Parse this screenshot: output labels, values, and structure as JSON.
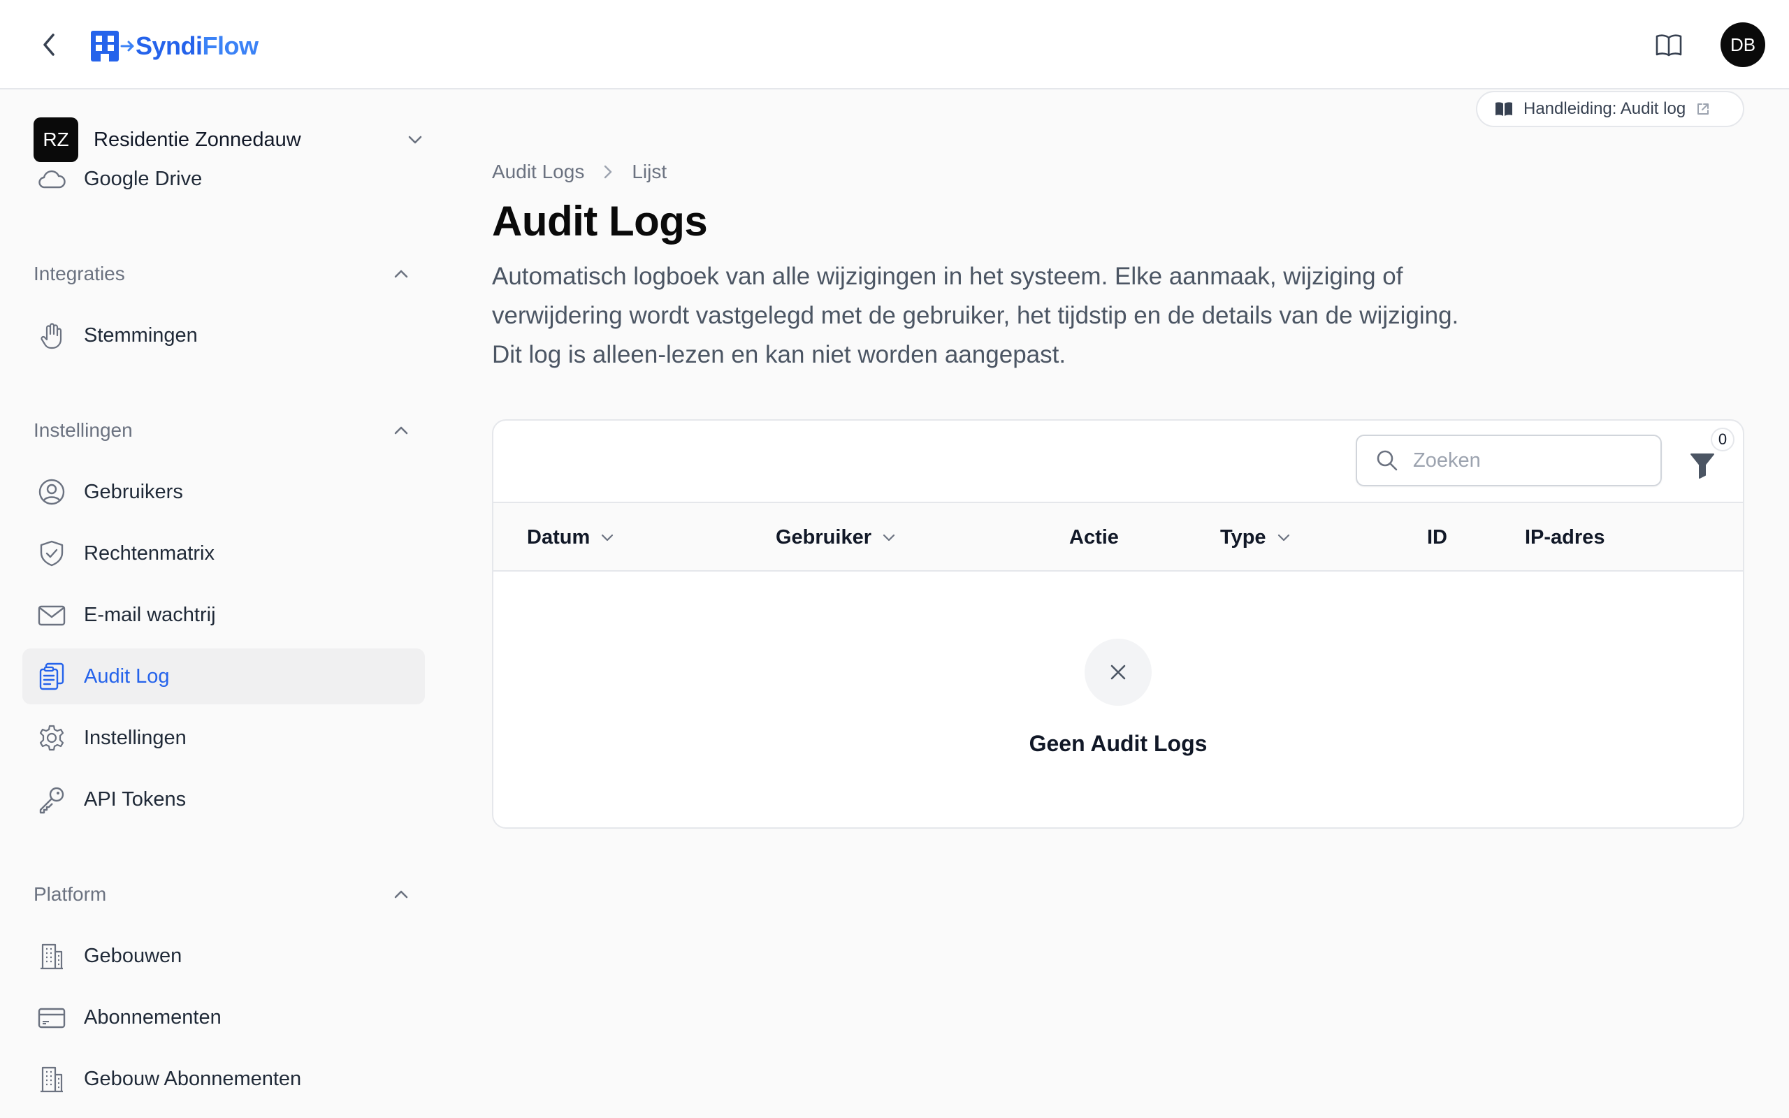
{
  "app": {
    "logo_part1": "Syndi",
    "logo_part2": "Flow",
    "user_initials": "DB"
  },
  "sidebar": {
    "tenant": {
      "initials": "RZ",
      "name": "Residentie Zonnedauw"
    },
    "partial_item": {
      "label": "Google Drive",
      "icon": "cloud-icon"
    },
    "groups": [
      {
        "label": "Integraties",
        "items": [
          {
            "label": "Stemmingen",
            "icon": "hand-icon"
          }
        ]
      },
      {
        "label": "Instellingen",
        "items": [
          {
            "label": "Gebruikers",
            "icon": "user-circle-icon"
          },
          {
            "label": "Rechtenmatrix",
            "icon": "shield-check-icon"
          },
          {
            "label": "E-mail wachtrij",
            "icon": "envelope-icon"
          },
          {
            "label": "Audit Log",
            "icon": "clipboard-list-icon",
            "active": true
          },
          {
            "label": "Instellingen",
            "icon": "cog-icon"
          },
          {
            "label": "API Tokens",
            "icon": "key-icon"
          }
        ]
      },
      {
        "label": "Platform",
        "items": [
          {
            "label": "Gebouwen",
            "icon": "building-icon"
          },
          {
            "label": "Abonnementen",
            "icon": "credit-card-icon"
          },
          {
            "label": "Gebouw Abonnementen",
            "icon": "building-icon"
          }
        ]
      }
    ]
  },
  "guide_button": {
    "label": "Handleiding: Audit log"
  },
  "breadcrumb": [
    "Audit Logs",
    "Lijst"
  ],
  "page": {
    "title": "Audit Logs",
    "description": "Automatisch logboek van alle wijzigingen in het systeem. Elke aanmaak, wijziging of verwijdering wordt vastgelegd met de gebruiker, het tijdstip en de details van de wijziging. Dit log is alleen-lezen en kan niet worden aangepast."
  },
  "table": {
    "search_placeholder": "Zoeken",
    "search_value": "",
    "filter_count": "0",
    "columns": [
      {
        "label": "Datum",
        "sortable": true
      },
      {
        "label": "Gebruiker",
        "sortable": true
      },
      {
        "label": "Actie",
        "sortable": false
      },
      {
        "label": "Type",
        "sortable": true
      },
      {
        "label": "ID",
        "sortable": false
      },
      {
        "label": "IP-adres",
        "sortable": false
      }
    ],
    "empty_title": "Geen Audit Logs"
  },
  "colors": {
    "accent": "#2563eb",
    "text": "#111827",
    "muted": "#6b7280",
    "border": "#e5e7eb"
  }
}
